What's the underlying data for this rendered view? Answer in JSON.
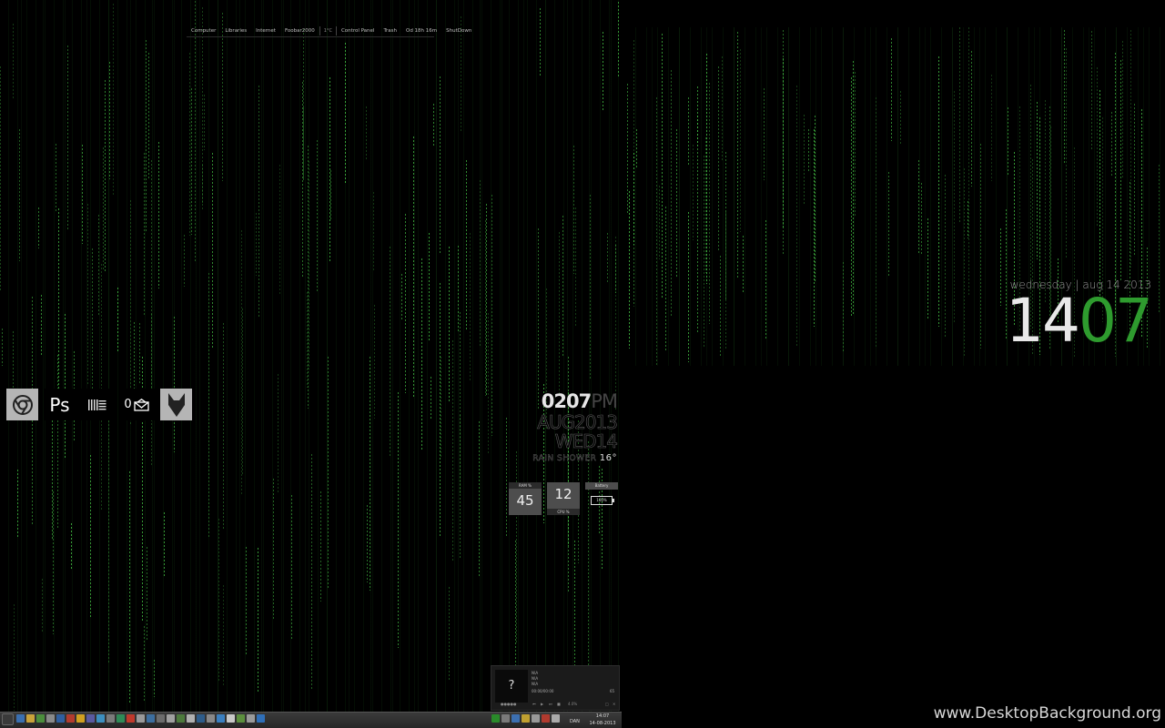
{
  "topbar": {
    "items": [
      "Computer",
      "Libraries",
      "Internet",
      "Foobar2000",
      "Control Panel",
      "Trash",
      "Od 18h 16m",
      "ShutDown"
    ],
    "temp": "1°C"
  },
  "dock": {
    "ps_label": "Ps",
    "mail_count": "0"
  },
  "center_clock": {
    "time": "0207",
    "ampm": "PM",
    "date_line1": "AUG2013",
    "date_line2": "WED14",
    "weather": "RAIN SHOWER",
    "temperature": "16°"
  },
  "stats": {
    "ram_label": "RAM %",
    "ram_value": "45",
    "cpu_label": "CPU %",
    "cpu_value": "12",
    "battery_label": "Battery",
    "battery_value": "100%"
  },
  "right_clock": {
    "date": "wednesday | aug 14 2013",
    "hours": "14",
    "minutes": "07"
  },
  "player": {
    "art": "?",
    "line1": "N\\A",
    "line2": "N\\A",
    "line3": "N\\A",
    "time": "00:00/00:00",
    "volume": "4.0%",
    "count": "65"
  },
  "taskbar": {
    "lang": "DAN",
    "time": "14:07",
    "date": "14-08-2013"
  },
  "watermark": "www.DesktopBackground.org",
  "colors": {
    "accent_green": "#2e9b2e",
    "tile_gray": "#b5b5b5",
    "stat_gray": "#4d4d4d"
  }
}
